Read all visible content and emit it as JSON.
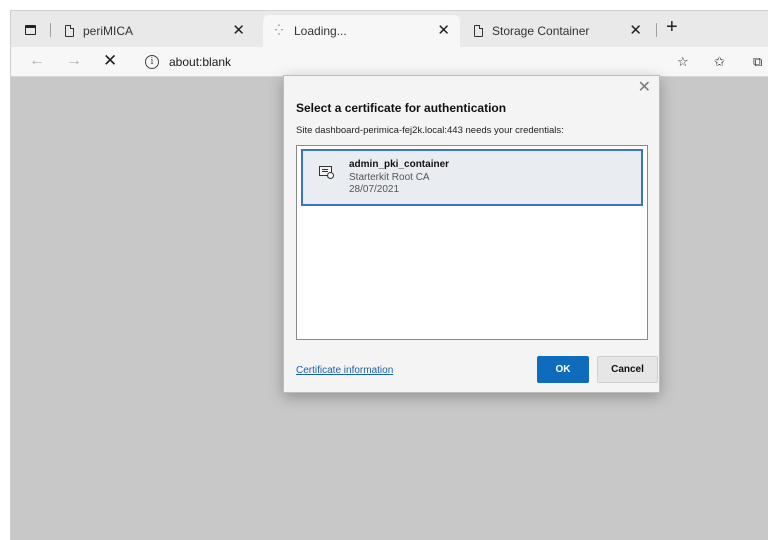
{
  "tabs": [
    {
      "label": "periMICA",
      "icon": "page-icon"
    },
    {
      "label": "Loading...",
      "icon": "loading-spinner-icon"
    },
    {
      "label": "Storage Container",
      "icon": "page-icon"
    }
  ],
  "toolbar": {
    "url": "about:blank"
  },
  "dialog": {
    "title": "Select a certificate for authentication",
    "description": "Site dashboard-perimica-fej2k.local:443 needs your credentials:",
    "certificate": {
      "name": "admin_pki_container",
      "issuer": "Starterkit Root CA",
      "date": "28/07/2021"
    },
    "info_link": "Certificate information",
    "ok_label": "OK",
    "cancel_label": "Cancel"
  },
  "colors": {
    "accent": "#0f6cbd",
    "selection_border": "#3b73c6",
    "page_background": "#c8c8c8"
  }
}
